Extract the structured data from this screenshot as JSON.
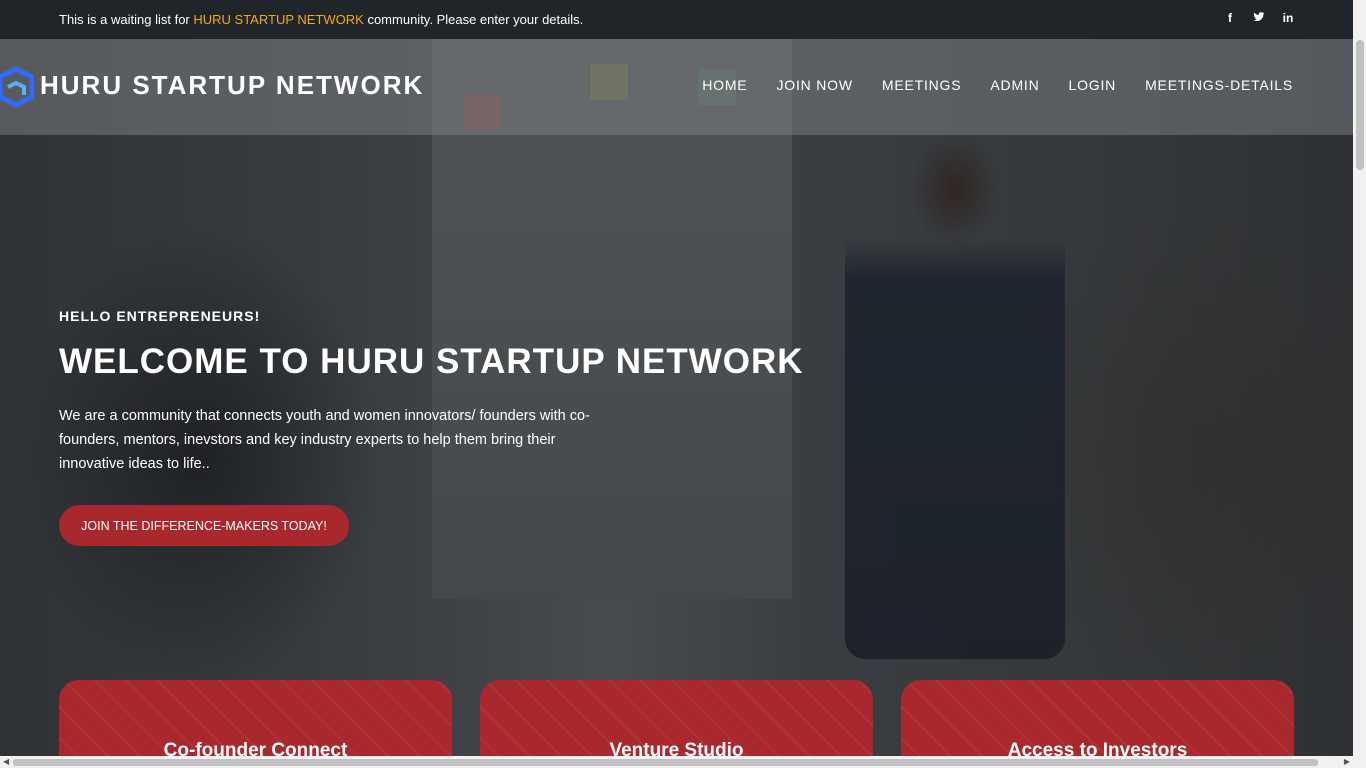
{
  "topbar": {
    "prefix": "This is a waiting list for ",
    "brand": "HURU STARTUP NETWORK",
    "suffix": " community. Please enter your details.",
    "socials": [
      "f",
      "t",
      "in"
    ]
  },
  "navbar": {
    "brand": "HURU STARTUP NETWORK",
    "items": [
      "HOME",
      "JOIN NOW",
      "MEETINGS",
      "ADMIN",
      "LOGIN",
      "MEETINGS-DETAILS"
    ]
  },
  "hero": {
    "eyebrow": "HELLO ENTREPRENEURS!",
    "headline": "WELCOME TO HURU STARTUP NETWORK",
    "description": "We are a community that connects youth and women innovators/ founders with co-founders, mentors, inevstors and key industry experts to help them bring their innovative ideas to life..",
    "cta": "JOIN THE DIFFERENCE-MAKERS TODAY!"
  },
  "cards": [
    "Co-founder Connect",
    "Venture Studio",
    "Access to Investors"
  ],
  "colors": {
    "accent": "#f5a623",
    "primary": "#a8282e",
    "topbar": "#1f2529",
    "logo": "#2f6bff"
  },
  "icons": [
    "facebook-icon",
    "twitter-icon",
    "linkedin-icon",
    "logo-icon"
  ]
}
